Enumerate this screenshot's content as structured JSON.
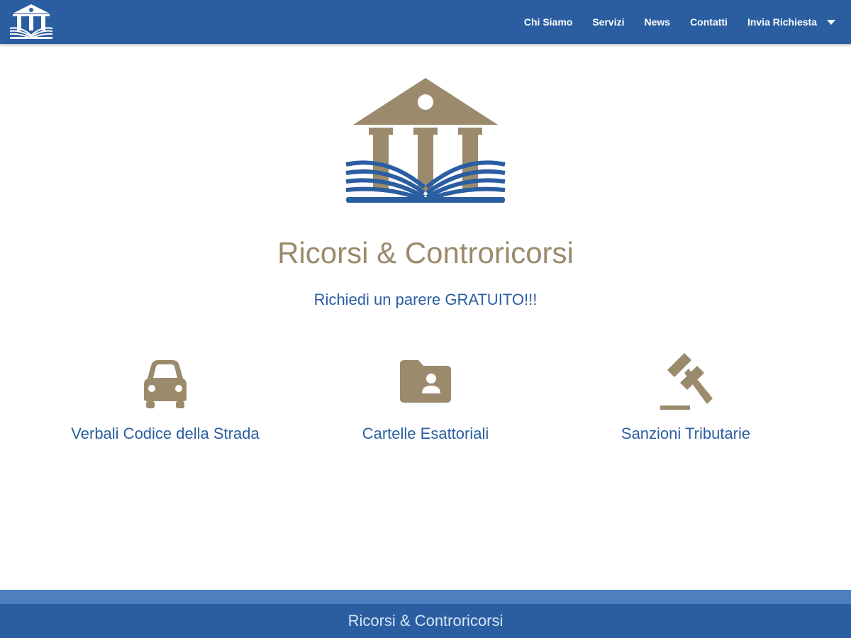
{
  "nav": {
    "logo_icon": "courthouse-book-logo-icon",
    "items": [
      "Chi Siamo",
      "Servizi",
      "News",
      "Contatti",
      "Invia Richiesta"
    ],
    "dropdown_icon": "caret-down-icon"
  },
  "hero": {
    "logo_icon": "courthouse-book-logo-icon",
    "title": "Ricorsi & Controricorsi",
    "subtitle": "Richiedi un parere GRATUITO!!!"
  },
  "services": [
    {
      "icon": "car-icon",
      "label": "Verbali Codice della Strada"
    },
    {
      "icon": "folder-user-icon",
      "label": "Cartelle Esattoriali"
    },
    {
      "icon": "gavel-icon",
      "label": "Sanzioni Tributarie"
    }
  ],
  "footer": {
    "text": "Ricorsi & Controricorsi"
  },
  "colors": {
    "primary_blue": "#2b5ea1",
    "gold": "#9b8a6b",
    "footer_strip": "#4e7fbf",
    "background": "#ffffff"
  }
}
